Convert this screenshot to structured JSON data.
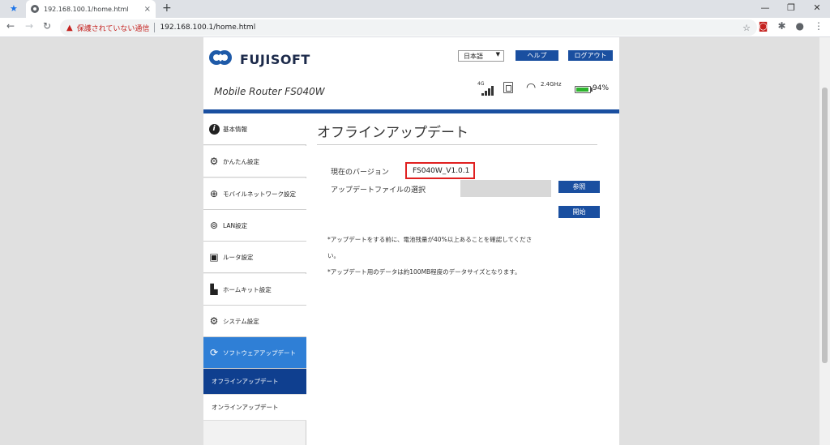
{
  "browser": {
    "tab_title": "192.168.100.1/home.html",
    "tab_close": "×",
    "new_tab": "+",
    "security_warning": "保護されていない通信",
    "url": "192.168.100.1/home.html",
    "window_controls": [
      "—",
      "❐",
      "✕"
    ]
  },
  "header": {
    "brand": "FUJISOFT",
    "language": "日本語",
    "help_label": "ヘルプ",
    "logout_label": "ログアウト",
    "model": "Mobile Router FS040W",
    "signal_label": "4G",
    "wifi_band": "2.4GHz",
    "battery_percent": "94%",
    "battery_level": 0.94,
    "accent_color": "#1a4fa0"
  },
  "sidebar": {
    "items": [
      {
        "label": "基本情報",
        "icon": "info-icon"
      },
      {
        "label": "かんたん設定",
        "icon": "gear-icon"
      },
      {
        "label": "モバイルネットワーク設定",
        "icon": "globe-icon"
      },
      {
        "label": "LAN設定",
        "icon": "antenna-icon"
      },
      {
        "label": "ルータ設定",
        "icon": "router-icon"
      },
      {
        "label": "ホームキット設定",
        "icon": "homekit-icon"
      },
      {
        "label": "システム設定",
        "icon": "gears-icon"
      },
      {
        "label": "ソフトウェアアップデート",
        "icon": "refresh-icon"
      }
    ],
    "sub_items": [
      {
        "label": "オフラインアップデート"
      },
      {
        "label": "オンラインアップデート"
      }
    ]
  },
  "main": {
    "title": "オフラインアップデート",
    "current_version_label": "現在のバージョン",
    "current_version": "FS040W_V1.0.1",
    "file_select_label": "アップデートファイルの選択",
    "browse_label": "参照",
    "start_label": "開始",
    "note_1a": "*アップデートをする前に、電池残量が40%以上あることを確認してくださ",
    "note_1b": "い。",
    "note_2": "*アップデート用のデータは約100MB程度のデータサイズとなります。"
  }
}
